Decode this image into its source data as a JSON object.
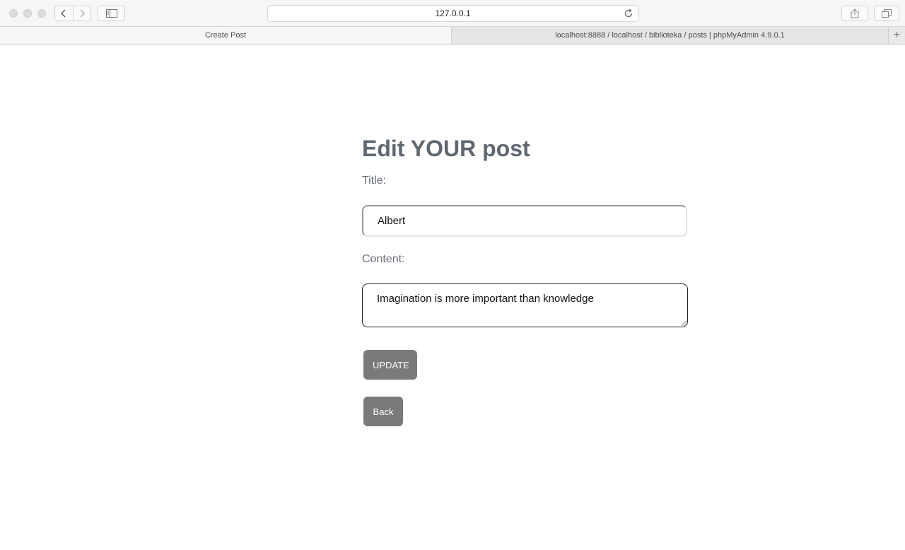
{
  "browser": {
    "url": "127.0.0.1",
    "tabs": [
      {
        "label": "Create Post",
        "active": true
      },
      {
        "label": "localhost:8888 / localhost / biblioteka / posts | phpMyAdmin 4.9.0.1",
        "active": false
      }
    ],
    "new_tab_label": "+"
  },
  "page": {
    "heading": "Edit YOUR post",
    "title_label": "Title:",
    "title_value": "Albert",
    "content_label": "Content:",
    "content_value": "Imagination is more important than knowledge",
    "update_button": "UPDATE",
    "back_button": "Back"
  },
  "colors": {
    "heading": "#5f6770",
    "button_bg": "#7a7a7a",
    "button_text": "#ffffff"
  }
}
